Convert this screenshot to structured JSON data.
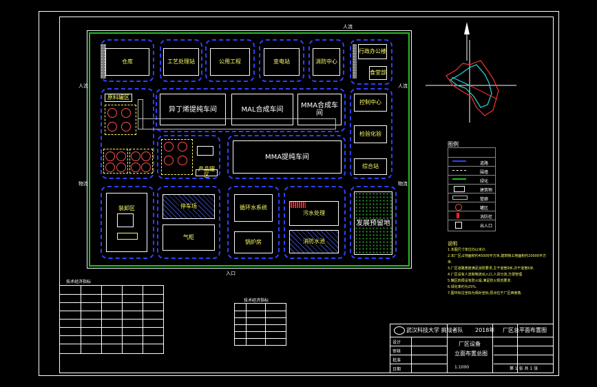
{
  "buildings": {
    "warehouse": "仓库",
    "workshop_office": "工艺处理站",
    "public_works": "公用工程",
    "transformer": "变电站",
    "fire_center": "消防中心",
    "office": "行政办公楼",
    "canteen": "食堂部",
    "raw_tank_area": "原料罐区",
    "butanol_workshop": "异丁烯提纯车间",
    "mal_workshop": "MAL合成车间",
    "mma_synth_workshop": "MMA合成车间",
    "control_center": "控制中心",
    "lab": "检验化验",
    "comprehensive": "综合站",
    "mma_purify_workshop": "MMA提纯车间",
    "product_tank_area": "产品罐区",
    "loading_area": "装卸区",
    "parking": "停车场",
    "gas_cabinet": "气柜",
    "cooling_tower": "循环水系统",
    "wastewater": "污水处理",
    "boiler": "锅炉房",
    "fire_pool": "消防水池",
    "reserve_land": "发展预留地"
  },
  "gates": {
    "north": "人流",
    "south": "入口",
    "east_top": "人流",
    "east_bottom": "物流",
    "west_top": "人流",
    "west_bottom": "物流"
  },
  "legend": {
    "title": "图例",
    "items": [
      "",
      "道路",
      "围墙",
      "绿化",
      "建筑物",
      "管廊",
      "罐区",
      "消防栓",
      "出入口"
    ]
  },
  "notes": {
    "title": "说明",
    "lines": [
      "1.本图尺寸单位均以米计.",
      "2.本厂区占地面积约45000平方米,建筑物占地面积约20000平方米.",
      "3.厂区道路宽度满足消防要求,主干道宽9米,次干道宽6米.",
      "4.厂区设有人流和物流出入口,人货分流,方便管理.",
      "5.罐区四周设有防火堤,满足防火规范要求.",
      "6.绿化率约为25%.",
      "7.图中标注坐标为相对坐标,原点位于厂区西南角."
    ]
  },
  "title_block": {
    "university": "武汉科技大学 挑战者队",
    "year": "2018年",
    "drawing_name": "厂区总平面布置图",
    "project": "厂区设备",
    "subtitle": "立面布置总图",
    "scale": "1:1000",
    "sheet": "第 1 张 共 1 张",
    "rows": [
      "设计",
      "审核",
      "批准",
      "日期"
    ]
  },
  "tables": {
    "left_title": "技术经济指标",
    "mid_title": "技术经济指标"
  }
}
